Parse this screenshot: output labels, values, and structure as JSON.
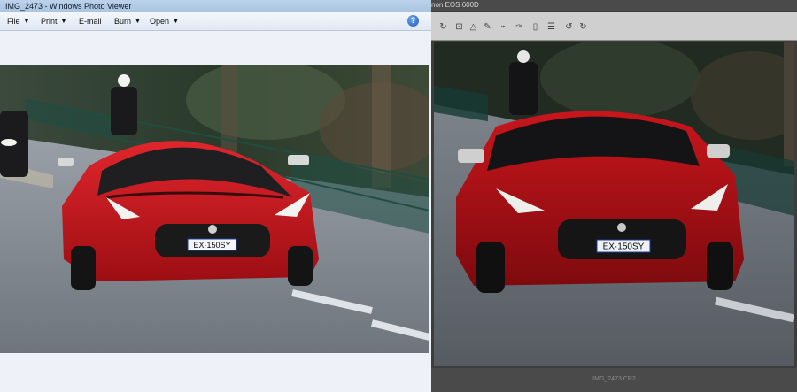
{
  "photo_viewer": {
    "title": "IMG_2473 - Windows Photo Viewer",
    "menu": {
      "file": "File",
      "print": "Print",
      "email": "E-mail",
      "burn": "Burn",
      "open": "Open"
    },
    "help_symbol": "?"
  },
  "canon_window": {
    "title": "non EOS 600D",
    "filename": "IMG_2473.CR2",
    "toolbar_icons": [
      "rotate-icon",
      "crop-icon",
      "dust-delete-icon",
      "stamp-icon",
      "brush-icon",
      "eyedropper-icon",
      "copy-icon",
      "list-icon",
      "rotate-left-icon",
      "rotate-right-icon"
    ]
  },
  "plate_text": "EX·150SY",
  "colors": {
    "car_red": "#c8161c",
    "fence_green": "#1f4d44",
    "road_gray": "#8a8f96"
  }
}
